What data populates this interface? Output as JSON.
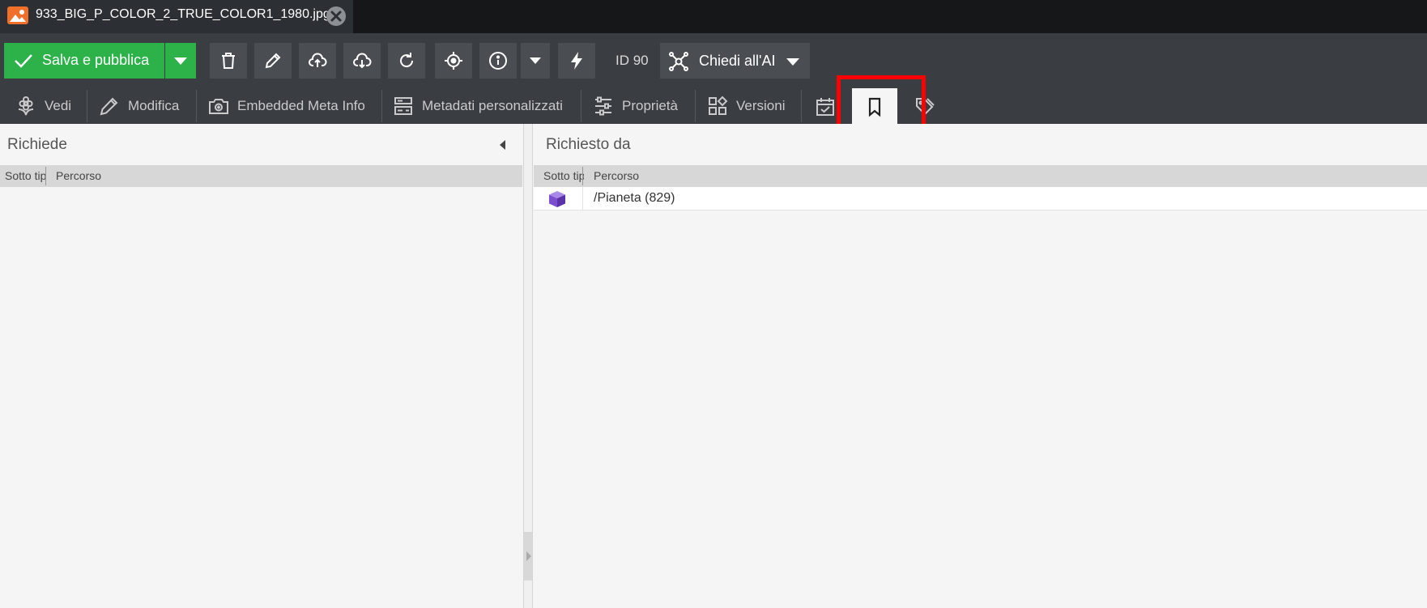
{
  "file_tab": {
    "title": "933_BIG_P_COLOR_2_TRUE_COLOR1_1980.jpg"
  },
  "toolbar": {
    "save_label": "Salva e pubblica",
    "id_label": "ID 90",
    "ai_label": "Chiedi all'AI"
  },
  "tabs": {
    "vedi": "Vedi",
    "modifica": "Modifica",
    "embedded": "Embedded Meta Info",
    "metadati": "Metadati personalizzati",
    "proprieta": "Proprietà",
    "versioni": "Versioni"
  },
  "left_panel": {
    "title": "Richiede",
    "columns": [
      "Sotto tipo",
      "Percorso"
    ]
  },
  "right_panel": {
    "title": "Richiesto da",
    "columns": [
      "Sotto tipo",
      "Percorso"
    ],
    "rows": [
      {
        "icon": "object-cube-icon",
        "path": "/Pianeta (829)"
      }
    ]
  },
  "colors": {
    "save_green": "#2db24a",
    "toolbar_bg": "#3a3d41",
    "highlight_red": "#ff0000",
    "cube_purple": "#7b4fcf"
  }
}
